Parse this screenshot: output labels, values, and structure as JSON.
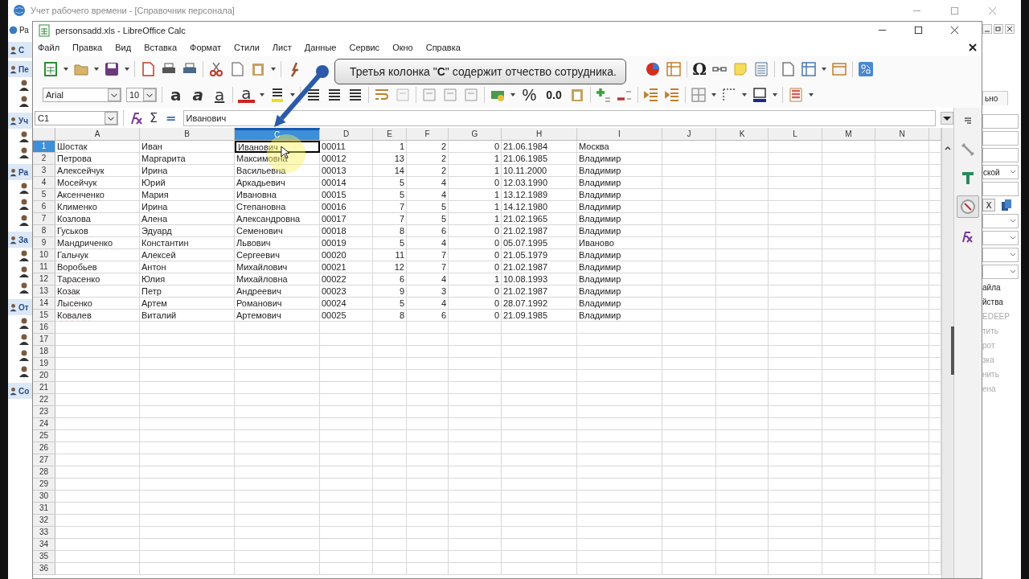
{
  "background_window": {
    "title": "Учет рабочего времени - [Справочник персонала]",
    "left_panel": [
      {
        "kind": "root",
        "label": "Ра"
      },
      {
        "kind": "header",
        "label": "С"
      },
      {
        "kind": "header",
        "label": "Пе"
      },
      {
        "kind": "icon"
      },
      {
        "kind": "icon"
      },
      {
        "kind": "header",
        "label": "Уч"
      },
      {
        "kind": "icon"
      },
      {
        "kind": "icon"
      },
      {
        "kind": "header",
        "label": "Ра"
      },
      {
        "kind": "icon"
      },
      {
        "kind": "icon"
      },
      {
        "kind": "icon"
      },
      {
        "kind": "header",
        "label": "За"
      },
      {
        "kind": "icon"
      },
      {
        "kind": "icon"
      },
      {
        "kind": "icon"
      },
      {
        "kind": "header",
        "label": "От"
      },
      {
        "kind": "icon"
      },
      {
        "kind": "icon"
      },
      {
        "kind": "icon"
      },
      {
        "kind": "icon"
      },
      {
        "kind": "header",
        "label": "Со"
      }
    ],
    "right_panel": [
      {
        "kind": "tab",
        "label": "ьно"
      },
      {
        "kind": "field"
      },
      {
        "kind": "field"
      },
      {
        "kind": "field"
      },
      {
        "kind": "dropdown",
        "label": "ской"
      },
      {
        "kind": "field"
      },
      {
        "kind": "button",
        "label": "X"
      },
      {
        "kind": "dropdown"
      },
      {
        "kind": "dropdown"
      },
      {
        "kind": "dropdown"
      },
      {
        "kind": "dropdown"
      },
      {
        "kind": "link",
        "label": "айла",
        "disabled": false
      },
      {
        "kind": "link",
        "label": "йства",
        "disabled": false
      },
      {
        "kind": "link",
        "label": "EDEEP",
        "disabled": true
      },
      {
        "kind": "link",
        "label": "тить",
        "disabled": true
      },
      {
        "kind": "link",
        "label": "рот",
        "disabled": true
      },
      {
        "kind": "link",
        "label": "зка",
        "disabled": true
      },
      {
        "kind": "link",
        "label": "нить",
        "disabled": true
      },
      {
        "kind": "link",
        "label": "ена",
        "disabled": true
      }
    ]
  },
  "calc_window": {
    "title": "personsadd.xls - LibreOffice Calc",
    "menu": [
      "Файл",
      "Правка",
      "Вид",
      "Вставка",
      "Формат",
      "Стили",
      "Лист",
      "Данные",
      "Сервис",
      "Окно",
      "Справка"
    ],
    "special_character": "Ω",
    "font_name": "Arial",
    "font_size": "10",
    "text_style_buttons": [
      {
        "kind": "bold",
        "label": "a"
      },
      {
        "kind": "italic",
        "label": "a"
      },
      {
        "kind": "underline",
        "label": "a"
      },
      {
        "kind": "font-color",
        "label": "a"
      }
    ],
    "percent": "%",
    "number_format": "0.0",
    "name_box": "C1",
    "sum": "Σ",
    "equals": "=",
    "formula": "Иванович",
    "columns": [
      {
        "label": "A",
        "selected": false
      },
      {
        "label": "B",
        "selected": false
      },
      {
        "label": "C",
        "selected": true
      },
      {
        "label": "D",
        "selected": false
      },
      {
        "label": "E",
        "selected": false
      },
      {
        "label": "F",
        "selected": false
      },
      {
        "label": "G",
        "selected": false
      },
      {
        "label": "H",
        "selected": false
      },
      {
        "label": "I",
        "selected": false
      },
      {
        "label": "J",
        "selected": false
      },
      {
        "label": "K",
        "selected": false
      },
      {
        "label": "L",
        "selected": false
      },
      {
        "label": "M",
        "selected": false
      },
      {
        "label": "N",
        "selected": false
      }
    ],
    "rows": [
      {
        "number": "1",
        "selected": true,
        "misspelled": true,
        "cells": [
          "Шостак",
          "Иван",
          "Иванович",
          "00011",
          "1",
          "2",
          "0",
          "21.06.1984",
          "Москва"
        ]
      },
      {
        "number": "2",
        "selected": false,
        "misspelled": false,
        "cells": [
          "Петрова",
          "Маргарита",
          "Максимовна",
          "00012",
          "13",
          "2",
          "1",
          "21.06.1985",
          "Владимир"
        ]
      },
      {
        "number": "3",
        "selected": false,
        "misspelled": true,
        "cells": [
          "Алексейчук",
          "Ирина",
          "Васильевна",
          "00013",
          "14",
          "2",
          "1",
          "10.11.2000",
          "Владимир"
        ]
      },
      {
        "number": "4",
        "selected": false,
        "misspelled": true,
        "cells": [
          "Мосейчук",
          "Юрий",
          "Аркадьевич",
          "00014",
          "5",
          "4",
          "0",
          "12.03.1990",
          "Владимир"
        ]
      },
      {
        "number": "5",
        "selected": false,
        "misspelled": true,
        "cells": [
          "Аксенченко",
          "Мария",
          "Ивановна",
          "00015",
          "5",
          "4",
          "1",
          "13.12.1989",
          "Владимир"
        ]
      },
      {
        "number": "6",
        "selected": false,
        "misspelled": true,
        "cells": [
          "Клименко",
          "Ирина",
          "Степановна",
          "00016",
          "7",
          "5",
          "1",
          "14.12.1980",
          "Владимир"
        ]
      },
      {
        "number": "7",
        "selected": false,
        "misspelled": true,
        "cells": [
          "Козлова",
          "Алена",
          "Александровна",
          "00017",
          "7",
          "5",
          "1",
          "21.02.1965",
          "Владимир"
        ]
      },
      {
        "number": "8",
        "selected": false,
        "misspelled": false,
        "cells": [
          "Гуськов",
          "Эдуард",
          "Семенович",
          "00018",
          "8",
          "6",
          "0",
          "21.02.1987",
          "Владимир"
        ]
      },
      {
        "number": "9",
        "selected": false,
        "misspelled": true,
        "cells": [
          "Мандриченко",
          "Константин",
          "Львович",
          "00019",
          "5",
          "4",
          "0",
          "05.07.1995",
          "Иваново"
        ]
      },
      {
        "number": "10",
        "selected": false,
        "misspelled": true,
        "cells": [
          "Гальчук",
          "Алексей",
          "Сергеевич",
          "00020",
          "11",
          "7",
          "0",
          "21.05.1979",
          "Владимир"
        ]
      },
      {
        "number": "11",
        "selected": false,
        "misspelled": false,
        "cells": [
          "Воробьев",
          "Антон",
          "Михайлович",
          "00021",
          "12",
          "7",
          "0",
          "21.02.1987",
          "Владимир"
        ]
      },
      {
        "number": "12",
        "selected": false,
        "misspelled": true,
        "cells": [
          "Тарасенко",
          "Юлия",
          "Михайловна",
          "00022",
          "6",
          "4",
          "1",
          "10.08.1993",
          "Владимир"
        ]
      },
      {
        "number": "13",
        "selected": false,
        "misspelled": true,
        "cells": [
          "Козак",
          "Петр",
          "Андреевич",
          "00023",
          "9",
          "3",
          "0",
          "21.02.1987",
          "Владимир"
        ]
      },
      {
        "number": "14",
        "selected": false,
        "misspelled": true,
        "cells": [
          "Лысенко",
          "Артем",
          "Романович",
          "00024",
          "5",
          "4",
          "0",
          "28.07.1992",
          "Владимир"
        ]
      },
      {
        "number": "15",
        "selected": false,
        "misspelled": true,
        "cells": [
          "Ковалев",
          "Виталий",
          "Артемович",
          "00025",
          "8",
          "6",
          "0",
          "21.09.1985",
          "Владимир"
        ]
      }
    ],
    "empty_rows": [
      "16",
      "17",
      "18",
      "19",
      "20",
      "21",
      "22",
      "23",
      "24",
      "25",
      "26",
      "27",
      "28",
      "29",
      "30",
      "31",
      "32",
      "33",
      "34",
      "35",
      "36"
    ],
    "sidebar_tabs": [
      {
        "kind": "properties",
        "selected": false
      },
      {
        "kind": "styles",
        "selected": false
      },
      {
        "kind": "gallery",
        "selected": false
      },
      {
        "kind": "navigator",
        "selected": true
      },
      {
        "kind": "functions",
        "selected": false
      }
    ]
  },
  "callout": {
    "text": "Третья колонка \"**C**\" содержит отчество сотрудника."
  }
}
